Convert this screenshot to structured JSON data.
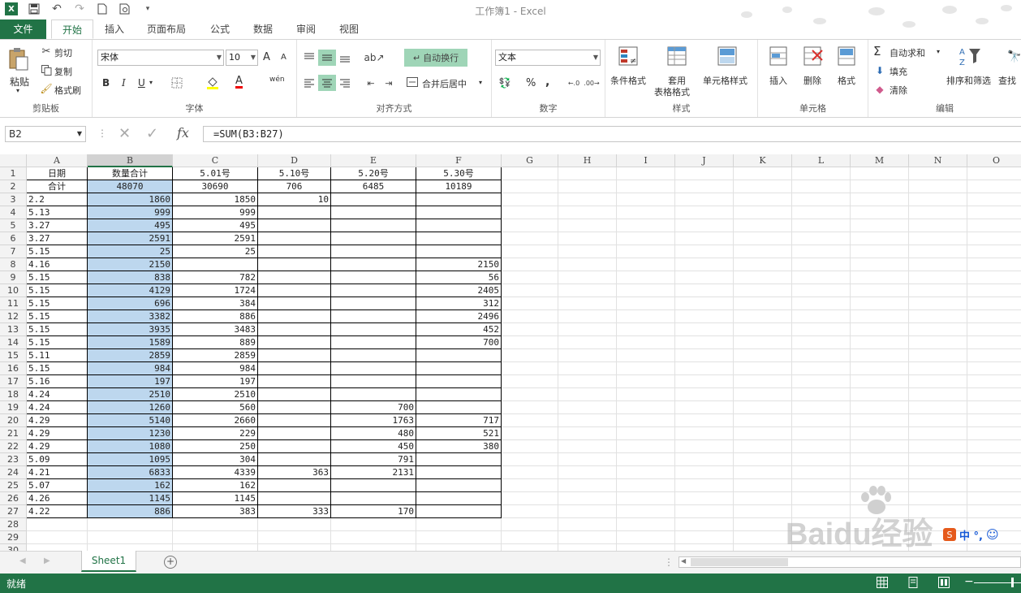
{
  "app": {
    "title": "工作簿1 - Excel"
  },
  "qat": {
    "logo": "X"
  },
  "tabs": [
    {
      "label": "文件"
    },
    {
      "label": "开始"
    },
    {
      "label": "插入"
    },
    {
      "label": "页面布局"
    },
    {
      "label": "公式"
    },
    {
      "label": "数据"
    },
    {
      "label": "审阅"
    },
    {
      "label": "视图"
    }
  ],
  "ribbon": {
    "clipboard": {
      "paste": "粘贴",
      "cut": "剪切",
      "copy": "复制",
      "format_painter": "格式刷",
      "label": "剪贴板"
    },
    "font": {
      "name": "宋体",
      "size": "10",
      "label": "字体",
      "bold": "B",
      "italic": "I",
      "underline": "U",
      "grow": "A",
      "shrink": "A",
      "font_color": "A",
      "phonetic": "wén"
    },
    "alignment": {
      "wrap": "自动换行",
      "merge": "合并后居中",
      "label": "对齐方式"
    },
    "number": {
      "format": "文本",
      "label": "数字",
      "percent": "%",
      "comma": ","
    },
    "styles": {
      "conditional": "条件格式",
      "table_line1": "套用",
      "table_line2": "表格格式",
      "cell_styles": "单元格样式",
      "label": "样式"
    },
    "cells": {
      "insert": "插入",
      "delete": "删除",
      "format": "格式",
      "label": "单元格"
    },
    "editing": {
      "autosum": "自动求和",
      "fill": "填充",
      "clear": "清除",
      "sort": "排序和筛选",
      "find": "查找",
      "label": "编辑"
    }
  },
  "formula_bar": {
    "name_box": "B2",
    "fx": "fx",
    "formula": "=SUM(B3:B27)"
  },
  "columns": [
    "A",
    "B",
    "C",
    "D",
    "E",
    "F",
    "G",
    "H",
    "I",
    "J",
    "K",
    "L",
    "M",
    "N",
    "O",
    "P"
  ],
  "rows": [
    [
      "日期",
      "数量合计",
      "5.01号",
      "5.10号",
      "5.20号",
      "5.30号"
    ],
    [
      "合计",
      "48070",
      "30690",
      "706",
      "6485",
      "10189"
    ],
    [
      "2.2",
      "1860",
      "1850",
      "10",
      "",
      ""
    ],
    [
      "5.13",
      "999",
      "999",
      "",
      "",
      ""
    ],
    [
      "3.27",
      "495",
      "495",
      "",
      "",
      ""
    ],
    [
      "3.27",
      "2591",
      "2591",
      "",
      "",
      ""
    ],
    [
      "5.15",
      "25",
      "25",
      "",
      "",
      ""
    ],
    [
      "4.16",
      "2150",
      "",
      "",
      "",
      "2150"
    ],
    [
      "5.15",
      "838",
      "782",
      "",
      "",
      "56"
    ],
    [
      "5.15",
      "4129",
      "1724",
      "",
      "",
      "2405"
    ],
    [
      "5.15",
      "696",
      "384",
      "",
      "",
      "312"
    ],
    [
      "5.15",
      "3382",
      "886",
      "",
      "",
      "2496"
    ],
    [
      "5.15",
      "3935",
      "3483",
      "",
      "",
      "452"
    ],
    [
      "5.15",
      "1589",
      "889",
      "",
      "",
      "700"
    ],
    [
      "5.11",
      "2859",
      "2859",
      "",
      "",
      ""
    ],
    [
      "5.15",
      "984",
      "984",
      "",
      "",
      ""
    ],
    [
      "5.16",
      "197",
      "197",
      "",
      "",
      ""
    ],
    [
      "4.24",
      "2510",
      "2510",
      "",
      "",
      ""
    ],
    [
      "4.24",
      "1260",
      "560",
      "",
      "700",
      ""
    ],
    [
      "4.29",
      "5140",
      "2660",
      "",
      "1763",
      "717"
    ],
    [
      "4.29",
      "1230",
      "229",
      "",
      "480",
      "521"
    ],
    [
      "4.29",
      "1080",
      "250",
      "",
      "450",
      "380"
    ],
    [
      "5.09",
      "1095",
      "304",
      "",
      "791",
      ""
    ],
    [
      "4.21",
      "6833",
      "4339",
      "363",
      "2131",
      ""
    ],
    [
      "5.07",
      "162",
      "162",
      "",
      "",
      ""
    ],
    [
      "4.26",
      "1145",
      "1145",
      "",
      "",
      ""
    ],
    [
      "4.22",
      "886",
      "383",
      "333",
      "170",
      ""
    ]
  ],
  "row_count": 30,
  "sheet": {
    "tab": "Sheet1"
  },
  "status": {
    "text": "就绪"
  },
  "watermark": {
    "brand": "Baidu经验",
    "url": "jingyan.baidu.com",
    "ime": "中 °,"
  },
  "colors": {
    "accent": "#217346",
    "selection": "#bdd7ee",
    "highlight": "#9fd5b7"
  }
}
